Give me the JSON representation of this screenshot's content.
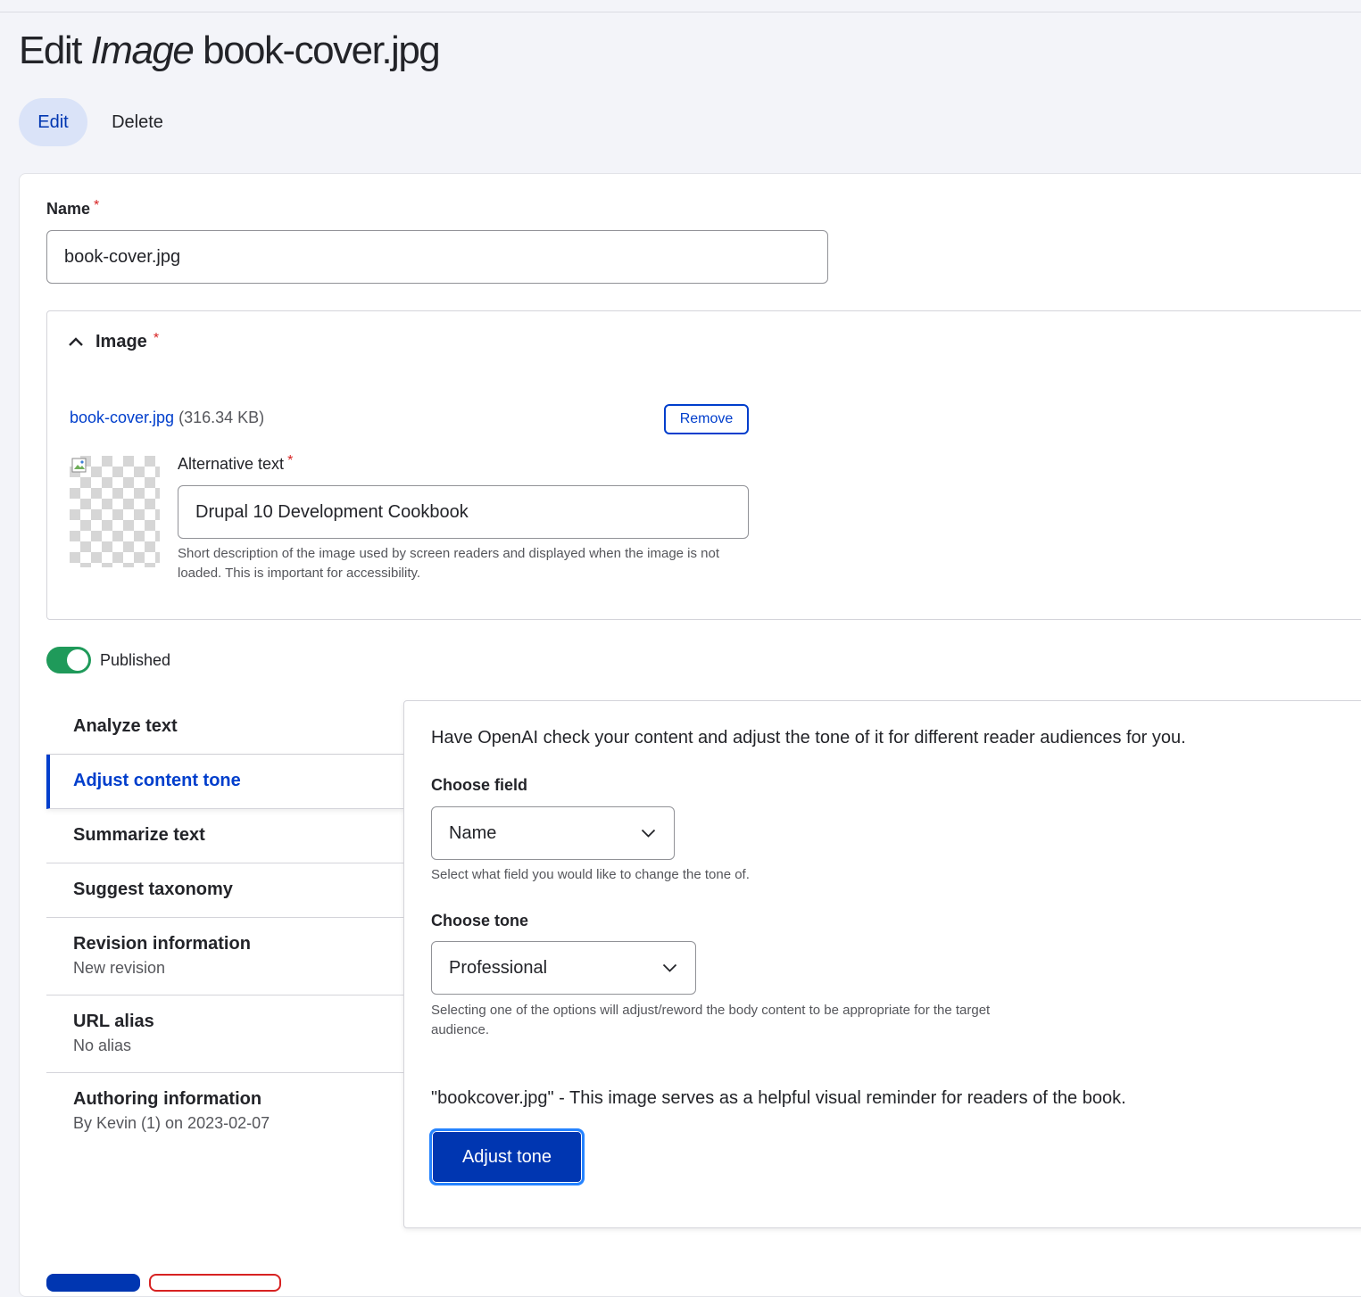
{
  "header": {
    "title_prefix": "Edit",
    "title_type": "Image",
    "title_name": "book-cover.jpg"
  },
  "tabs": [
    {
      "label": "Edit",
      "active": true
    },
    {
      "label": "Delete",
      "active": false
    }
  ],
  "form": {
    "name": {
      "label": "Name",
      "value": "book-cover.jpg",
      "required": "*"
    },
    "image": {
      "legend": "Image",
      "required": "*",
      "file_name": "book-cover.jpg",
      "file_size": "(316.34 KB)",
      "remove_label": "Remove",
      "alt_label": "Alternative text",
      "alt_value": "Drupal 10 Development Cookbook",
      "alt_description": "Short description of the image used by screen readers and displayed when the image is not loaded. This is important for accessibility."
    },
    "published": {
      "label": "Published",
      "checked": true
    }
  },
  "vertical_tabs": [
    {
      "title": "Analyze text",
      "summary": ""
    },
    {
      "title": "Adjust content tone",
      "summary": "",
      "active": true
    },
    {
      "title": "Summarize text",
      "summary": ""
    },
    {
      "title": "Suggest taxonomy",
      "summary": ""
    },
    {
      "title": "Revision information",
      "summary": "New revision"
    },
    {
      "title": "URL alias",
      "summary": "No alias"
    },
    {
      "title": "Authoring information",
      "summary": "By Kevin (1) on 2023-02-07"
    }
  ],
  "tone_panel": {
    "intro": "Have OpenAI check your content and adjust the tone of it for different reader audiences for you.",
    "field_label": "Choose field",
    "field_value": "Name",
    "field_description": "Select what field you would like to change the tone of.",
    "tone_label": "Choose tone",
    "tone_value": "Professional",
    "tone_description": "Selecting one of the options will adjust/reword the body content to be appropriate for the target audience.",
    "result": "\"bookcover.jpg\" - This image serves as a helpful visual reminder for readers of the book.",
    "button_label": "Adjust tone"
  },
  "colors": {
    "accent": "#003ecc",
    "primary_button": "#0036b1",
    "toggle_on": "#1f9a5a",
    "required": "#d72222"
  }
}
